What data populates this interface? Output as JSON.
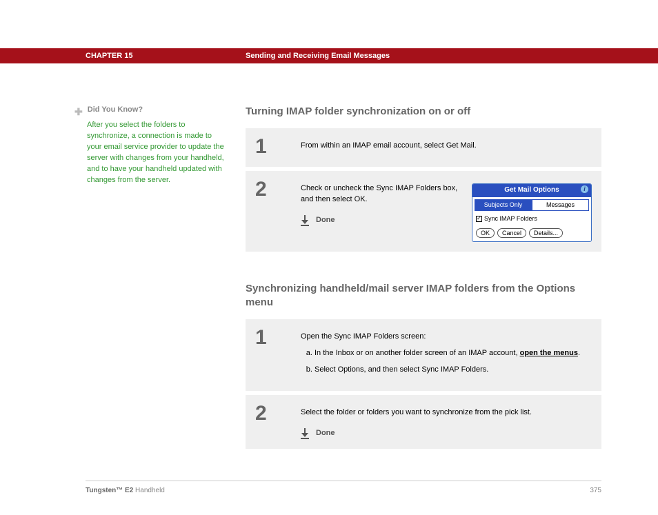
{
  "header": {
    "chapter": "CHAPTER 15",
    "title": "Sending and Receiving Email Messages"
  },
  "sidebar": {
    "plus": "✚",
    "heading": "Did You Know?",
    "body": "After you select the folders to synchronize, a connection is made to your email service provider to update the server with changes from your handheld, and to have your handheld updated with changes from the server."
  },
  "section1": {
    "heading": "Turning IMAP folder synchronization on or off",
    "step1": {
      "num": "1",
      "text": "From within an IMAP email account, select Get Mail."
    },
    "step2": {
      "num": "2",
      "text": "Check or uncheck the Sync IMAP Folders box, and then select OK.",
      "done": "Done"
    }
  },
  "device": {
    "title": "Get Mail Options",
    "tab_active": "Subjects Only",
    "tab_inactive": "Messages",
    "check_label": "Sync IMAP Folders",
    "btn_ok": "OK",
    "btn_cancel": "Cancel",
    "btn_details": "Details..."
  },
  "section2": {
    "heading": "Synchronizing handheld/mail server IMAP folders from the Options menu",
    "step1": {
      "num": "1",
      "intro": "Open the Sync IMAP Folders screen:",
      "a_pre": "In the Inbox or on another folder screen of an IMAP account, ",
      "a_link": "open the menus",
      "a_post": ".",
      "b": "Select Options, and then select Sync IMAP Folders."
    },
    "step2": {
      "num": "2",
      "text": "Select the folder or folders you want to synchronize from the pick list.",
      "done": "Done"
    }
  },
  "footer": {
    "product_bold": "Tungsten™ E2",
    "product_rest": " Handheld",
    "page": "375"
  }
}
